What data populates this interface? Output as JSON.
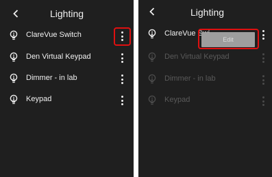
{
  "left_panel": {
    "title": "Lighting",
    "items": [
      {
        "label": "ClareVue Switch"
      },
      {
        "label": "Den Virtual Keypad"
      },
      {
        "label": "Dimmer - in lab"
      },
      {
        "label": "Keypad"
      }
    ]
  },
  "right_panel": {
    "title": "Lighting",
    "items": [
      {
        "label": "ClareVue Swi"
      },
      {
        "label": "Den Virtual Keypad"
      },
      {
        "label": "Dimmer - in lab"
      },
      {
        "label": "Keypad"
      }
    ],
    "menu": {
      "edit_label": "Edit"
    }
  },
  "colors": {
    "background": "#1f1f1f",
    "highlight": "#e01010",
    "menu": "#9e9e9e"
  },
  "icons": [
    "back-chevron-icon",
    "light-bulb-icon",
    "more-vertical-icon"
  ]
}
